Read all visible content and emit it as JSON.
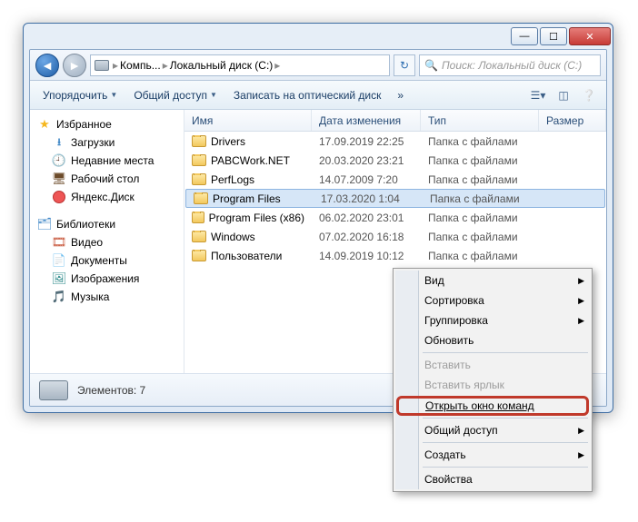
{
  "breadcrumbs": [
    "Компь...",
    "Локальный диск (C:)"
  ],
  "search_placeholder": "Поиск: Локальный диск (C:)",
  "toolbar": {
    "organize": "Упорядочить",
    "share": "Общий доступ",
    "burn": "Записать на оптический диск",
    "more": "»"
  },
  "nav": {
    "favorites": "Избранное",
    "fav_items": [
      "Загрузки",
      "Недавние места",
      "Рабочий стол",
      "Яндекс.Диск"
    ],
    "libraries": "Библиотеки",
    "lib_items": [
      "Видео",
      "Документы",
      "Изображения",
      "Музыка"
    ]
  },
  "columns": {
    "name": "Имя",
    "date": "Дата изменения",
    "type": "Тип",
    "size": "Размер"
  },
  "rows": [
    {
      "name": "Drivers",
      "date": "17.09.2019 22:25",
      "type": "Папка с файлами"
    },
    {
      "name": "PABCWork.NET",
      "date": "20.03.2020 23:21",
      "type": "Папка с файлами"
    },
    {
      "name": "PerfLogs",
      "date": "14.07.2009 7:20",
      "type": "Папка с файлами"
    },
    {
      "name": "Program Files",
      "date": "17.03.2020 1:04",
      "type": "Папка с файлами",
      "selected": true
    },
    {
      "name": "Program Files (x86)",
      "date": "06.02.2020 23:01",
      "type": "Папка с файлами"
    },
    {
      "name": "Windows",
      "date": "07.02.2020 16:18",
      "type": "Папка с файлами"
    },
    {
      "name": "Пользователи",
      "date": "14.09.2019 10:12",
      "type": "Папка с файлами"
    }
  ],
  "status": "Элементов: 7",
  "context_menu": {
    "view": "Вид",
    "sort": "Сортировка",
    "group": "Группировка",
    "refresh": "Обновить",
    "paste": "Вставить",
    "paste_shortcut": "Вставить ярлык",
    "open_cmd": "Открыть окно команд",
    "share": "Общий доступ",
    "new": "Создать",
    "properties": "Свойства"
  }
}
